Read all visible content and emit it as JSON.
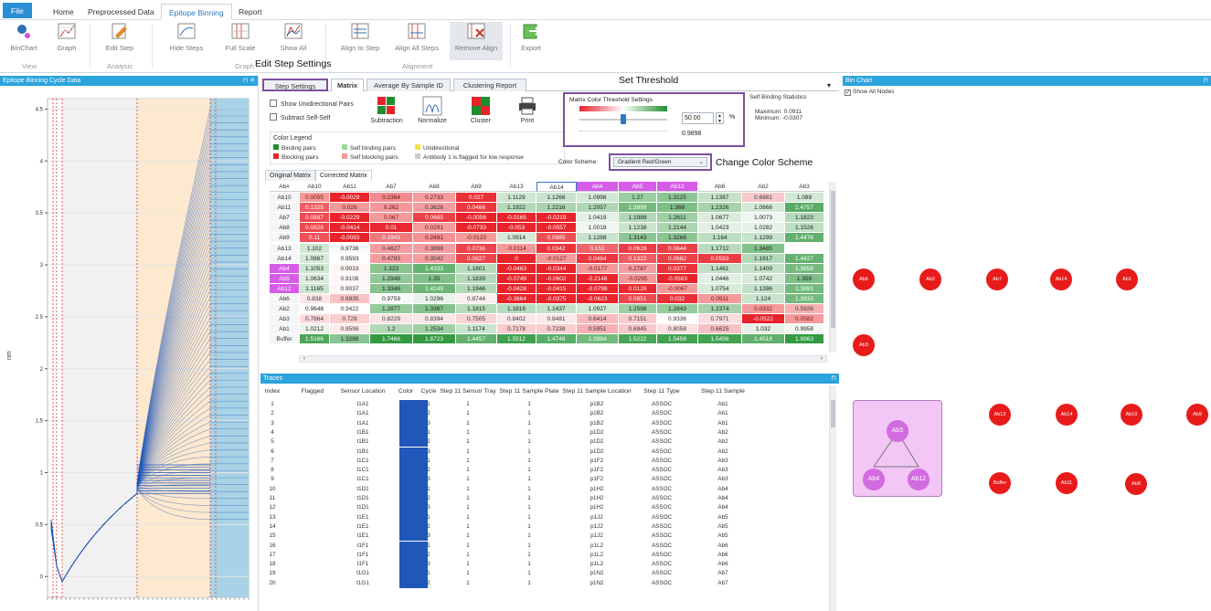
{
  "menu": {
    "tabs": [
      "File",
      "Home",
      "Preprocessed Data",
      "Epitope Binning",
      "Report"
    ],
    "active": "Epitope Binning"
  },
  "ribbon": {
    "buttons": {
      "binchart": "BinChart",
      "graph": "Graph",
      "edit_step": "Edit Step",
      "hide_steps": "Hide Steps",
      "full_scale": "Full Scale",
      "show_all": "Show All",
      "align_to_step": "Align to Step",
      "align_all_steps": "Align All Steps",
      "remove_align": "Remove Align",
      "export": "Export"
    },
    "groups": {
      "view": "View",
      "analysis": "Analysis",
      "graph": "Graph",
      "alignment": "Alignment"
    }
  },
  "annotations": {
    "edit_step_settings": "Edit Step Settings",
    "set_threshold": "Set Threshold",
    "change_color_scheme": "Change Color Scheme"
  },
  "left_panel": {
    "title": "Epitope Binning Cycle Data",
    "ylabel": "nm",
    "yticks": [
      "4.5",
      "4",
      "3.5",
      "3",
      "2.5",
      "2",
      "1.5",
      "1",
      "0.5",
      "0"
    ]
  },
  "center_tabs": [
    "Step Settings",
    "Matrix",
    "Average By Sample ID",
    "Clustering Report"
  ],
  "matrix_options": {
    "show_unidirectional": "Show Unidirectional Pairs",
    "subtract_self": "Subtract Self-Self",
    "tools": [
      "Subtraction",
      "Normalize",
      "Cluster",
      "Print"
    ]
  },
  "legend": {
    "title": "Color Legend",
    "items": [
      {
        "label": "Binding pairs",
        "color": "#1e8f2e"
      },
      {
        "label": "Self binding pairs",
        "color": "#9fd89a"
      },
      {
        "label": "Unidirectional",
        "color": "#f3e63a"
      },
      {
        "label": "Blocking pairs",
        "color": "#e8232a"
      },
      {
        "label": "Self blocking pairs",
        "color": "#f49a9a"
      },
      {
        "label": "Antibody 1 is flagged for low response",
        "color": "#cccccc"
      }
    ]
  },
  "matrix_subtabs": [
    "Original Matrix",
    "Corrected Matrix"
  ],
  "threshold": {
    "title": "Matrix Color Threshold Settings",
    "value": "50.00",
    "unit": "%",
    "computed": "0.9898",
    "slider_fraction": 0.5
  },
  "self_binding": {
    "title": "Self Binding Statistics",
    "maximum": "Maximum: 0.0911",
    "minimum": "Minimum: -0.0307"
  },
  "color_scheme": {
    "label": "Color Scheme:",
    "value": "Gradient Red/Green"
  },
  "matrix": {
    "columns": [
      "Ab#",
      "Ab10",
      "Ab11",
      "Ab7",
      "Ab8",
      "Ab9",
      "Ab13",
      "Ab14",
      "Ab4",
      "Ab5",
      "Ab12",
      "Ab6",
      "Ab2",
      "Ab3"
    ],
    "rows": [
      {
        "h": "Ab10",
        "v": [
          "0.0055",
          "-0.0029",
          "0.2364",
          "0.2733",
          "0.027",
          "1.1129",
          "1.1266",
          "1.0998",
          "1.27",
          "1.3125",
          "1.1387",
          "0.6981",
          "1.089"
        ]
      },
      {
        "h": "Ab11",
        "v": [
          "0.1325",
          "0.026",
          "0.262",
          "0.3626",
          "0.0466",
          "1.1922",
          "1.2216",
          "1.2057",
          "1.3899",
          "1.368",
          "1.2326",
          "1.0868",
          "1.4757"
        ]
      },
      {
        "h": "Ab7",
        "v": [
          "0.0887",
          "-0.0229",
          "0.067",
          "0.0685",
          "-0.0056",
          "-0.0165",
          "-0.0219",
          "1.0419",
          "1.1988",
          "1.2611",
          "1.0677",
          "1.0073",
          "1.1823"
        ]
      },
      {
        "h": "Ab8",
        "v": [
          "0.0828",
          "-0.0414",
          "0.01",
          "0.0291",
          "-0.0733",
          "-0.053",
          "-0.0557",
          "1.0018",
          "1.1238",
          "1.2144",
          "1.0423",
          "1.0282",
          "1.1526"
        ]
      },
      {
        "h": "Ab9",
        "v": [
          "0.11",
          "-0.0093",
          "0.1941",
          "0.2491",
          "-0.0123",
          "1.0914",
          "0.0985",
          "1.1288",
          "1.3143",
          "1.3266",
          "1.164",
          "1.1299",
          "1.4476"
        ]
      },
      {
        "h": "Ab13",
        "v": [
          "1.102",
          "0.9736",
          "0.4627",
          "0.3898",
          "0.0736",
          "-0.0114",
          "0.0342",
          "0.151",
          "0.0628",
          "0.0644",
          "1.1712",
          "1.3485"
        ]
      },
      {
        "h": "Ab14",
        "v": [
          "1.0867",
          "0.9593",
          "0.4793",
          "0.3542",
          "0.0827",
          "0",
          "-0.0127",
          "0.0464",
          "0.1322",
          "0.0682",
          "0.0583",
          "1.1917",
          "1.4427"
        ]
      },
      {
        "h": "Ab4",
        "v": [
          "1.1053",
          "0.9033",
          "1.323",
          "1.4333",
          "1.1801",
          "-0.0463",
          "-0.0344",
          "-0.0177",
          "0.2787",
          "0.0377",
          "1.1461",
          "1.1409",
          "1.3858"
        ]
      },
      {
        "h": "Ab5",
        "v": [
          "1.0634",
          "0.9108",
          "1.2948",
          "1.35",
          "1.1839",
          "-0.0749",
          "-0.0602",
          "-0.2148",
          "-0.0295",
          "-0.0583",
          "1.0446",
          "1.0742",
          "1.359"
        ]
      },
      {
        "h": "Ab12",
        "v": [
          "1.1165",
          "0.9037",
          "1.3346",
          "1.4149",
          "1.1946",
          "-0.0428",
          "-0.0415",
          "-0.0798",
          "0.0128",
          "-0.0067",
          "1.0754",
          "1.1396",
          "1.3891"
        ]
      },
      {
        "h": "Ab6",
        "v": [
          "0.838",
          "0.6835",
          "0.9759",
          "1.0296",
          "0.8744",
          "-0.3664",
          "-0.0375",
          "-0.0623",
          "0.0851",
          "0.032",
          "0.0911",
          "1.124",
          "1.3933"
        ]
      },
      {
        "h": "Ab2",
        "v": [
          "0.9648",
          "0.9422",
          "1.2877",
          "1.3367",
          "1.1815",
          "1.1816",
          "1.1437",
          "1.0927",
          "1.2598",
          "1.2843",
          "1.2374",
          "0.0332",
          "0.5926"
        ]
      },
      {
        "h": "Ab3",
        "v": [
          "0.7864",
          "0.729",
          "0.8229",
          "0.8394",
          "0.7505",
          "0.8402",
          "0.8481",
          "0.6414",
          "0.7151",
          "0.9336",
          "0.7971",
          "-0.0522",
          "0.0582"
        ]
      },
      {
        "h": "Ab1",
        "v": [
          "1.0212",
          "0.8598",
          "1.2",
          "1.2534",
          "1.1174",
          "0.7178",
          "0.7238",
          "0.5951",
          "0.6945",
          "0.8058",
          "0.6625",
          "1.032",
          "0.9958"
        ]
      },
      {
        "h": "Buffer",
        "v": [
          "1.5166",
          "1.3286",
          "1.7466",
          "1.8723",
          "1.4457",
          "1.5512",
          "1.4748",
          "1.3984",
          "1.5222",
          "1.5456",
          "1.5456",
          "1.4518",
          "1.9963"
        ]
      }
    ]
  },
  "traces": {
    "title": "Traces",
    "columns": [
      "Index",
      "Flagged",
      "Sensor Location",
      "Color",
      "Cycle",
      "Step 11 Sensor Tray",
      "Step 11 Sample Plate",
      "Step 11 Sample Location",
      "Step 11 Type",
      "Step 11 Sample"
    ],
    "rows": [
      [
        "1",
        "",
        "t1A1",
        "1",
        "1",
        "1",
        "p1B2",
        "ASSOC",
        "Ab1"
      ],
      [
        "2",
        "",
        "t1A1",
        "2",
        "1",
        "1",
        "p1B2",
        "ASSOC",
        "Ab1"
      ],
      [
        "3",
        "",
        "t1A1",
        "3",
        "1",
        "1",
        "p1B2",
        "ASSOC",
        "Ab1"
      ],
      [
        "4",
        "",
        "t1B1",
        "1",
        "1",
        "1",
        "p1D2",
        "ASSOC",
        "Ab2"
      ],
      [
        "5",
        "",
        "t1B1",
        "2",
        "1",
        "1",
        "p1D2",
        "ASSOC",
        "Ab2"
      ],
      [
        "6",
        "",
        "t1B1",
        "3",
        "1",
        "1",
        "p1D2",
        "ASSOC",
        "Ab2"
      ],
      [
        "7",
        "",
        "t1C1",
        "1",
        "1",
        "1",
        "p1F2",
        "ASSOC",
        "Ab3"
      ],
      [
        "8",
        "",
        "t1C1",
        "2",
        "1",
        "1",
        "p1F2",
        "ASSOC",
        "Ab3"
      ],
      [
        "9",
        "",
        "t1C1",
        "3",
        "1",
        "1",
        "p1F2",
        "ASSOC",
        "Ab3"
      ],
      [
        "10",
        "",
        "t1D1",
        "1",
        "1",
        "1",
        "p1H2",
        "ASSOC",
        "Ab4"
      ],
      [
        "11",
        "",
        "t1D1",
        "2",
        "1",
        "1",
        "p1H2",
        "ASSOC",
        "Ab4"
      ],
      [
        "12",
        "",
        "t1D1",
        "3",
        "1",
        "1",
        "p1H2",
        "ASSOC",
        "Ab4"
      ],
      [
        "13",
        "",
        "t1E1",
        "1",
        "1",
        "1",
        "p1J2",
        "ASSOC",
        "Ab5"
      ],
      [
        "14",
        "",
        "t1E1",
        "2",
        "1",
        "1",
        "p1J2",
        "ASSOC",
        "Ab5"
      ],
      [
        "15",
        "",
        "t1E1",
        "3",
        "1",
        "1",
        "p1J2",
        "ASSOC",
        "Ab5"
      ],
      [
        "16",
        "",
        "t1F1",
        "1",
        "1",
        "1",
        "p1L2",
        "ASSOC",
        "Ab6"
      ],
      [
        "17",
        "",
        "t1F1",
        "2",
        "1",
        "1",
        "p1L2",
        "ASSOC",
        "Ab6"
      ],
      [
        "18",
        "",
        "t1F1",
        "3",
        "1",
        "1",
        "p1L2",
        "ASSOC",
        "Ab6"
      ],
      [
        "19",
        "",
        "t1G1",
        "1",
        "1",
        "1",
        "p1N2",
        "ASSOC",
        "Ab7"
      ],
      [
        "20",
        "",
        "t1G1",
        "2",
        "1",
        "1",
        "p1N2",
        "ASSOC",
        "Ab7"
      ]
    ],
    "trace_color": "#2057b8"
  },
  "bin_chart": {
    "title": "Bin Chart",
    "show_all_nodes": "Show All Nodes",
    "nodes": [
      "Ab6",
      "Ab2",
      "Ab7",
      "Ab14",
      "Ab1",
      "Ab3",
      "Ab13",
      "Ab14",
      "Ab10",
      "Ab9",
      "Buffer",
      "Ab11",
      "Ab8"
    ],
    "cluster": [
      "Ab5",
      "Ab4",
      "Ab12"
    ]
  },
  "colors": {
    "accent": "#2ba3dc",
    "highlight_purple": "#7b4f9e",
    "magenta_header": "#d65ce8"
  }
}
